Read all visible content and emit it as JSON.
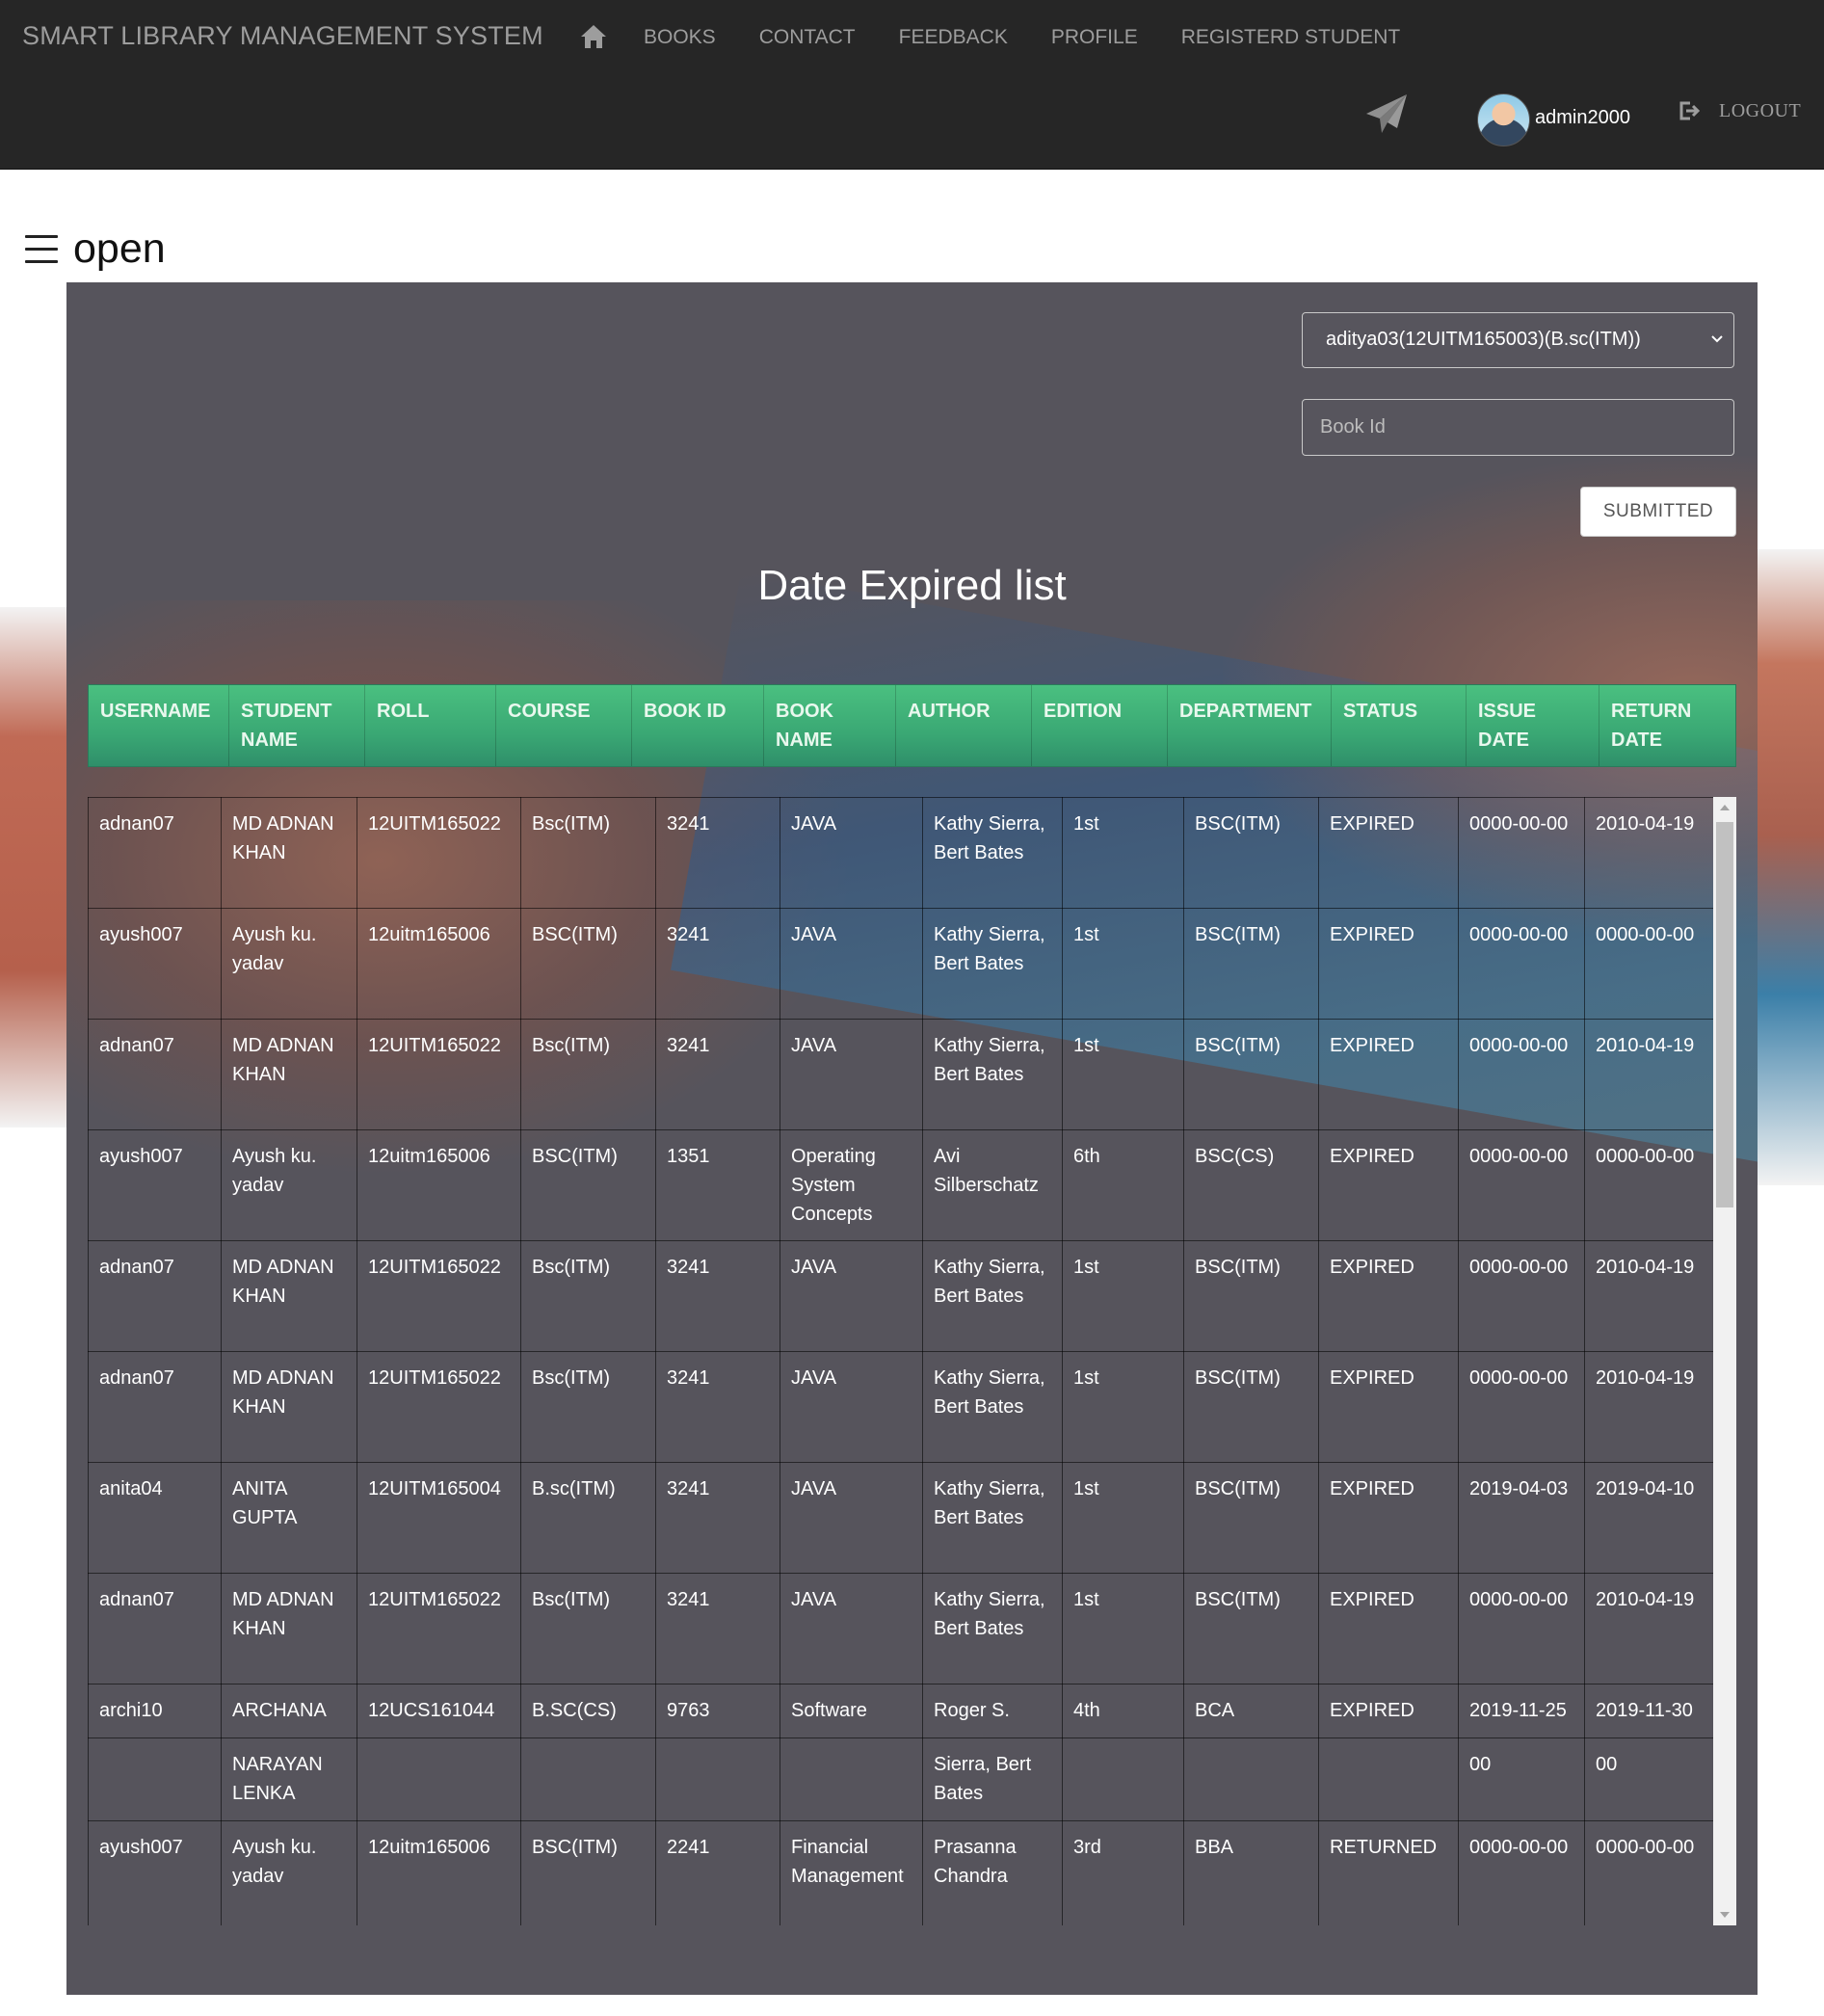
{
  "nav": {
    "brand": "SMART LIBRARY MANAGEMENT SYSTEM",
    "links": [
      "BOOKS",
      "CONTACT",
      "FEEDBACK",
      "PROFILE",
      "REGISTERD STUDENT"
    ],
    "user": "admin2000",
    "logout": "LOGOUT"
  },
  "sidebar_toggle": {
    "label": "open"
  },
  "form": {
    "student_selected": "aditya03(12UITM165003)(B.sc(ITM))",
    "book_id_placeholder": "Book Id",
    "submit": "SUBMITTED"
  },
  "list": {
    "title": "Date Expired list",
    "headers": [
      [
        "USERNAME"
      ],
      [
        "STUDENT",
        "NAME"
      ],
      [
        "ROLL"
      ],
      [
        "COURSE"
      ],
      [
        "BOOK ID"
      ],
      [
        "BOOK",
        "NAME"
      ],
      [
        "AUTHOR"
      ],
      [
        "EDITION"
      ],
      [
        "DEPARTMENT"
      ],
      [
        "STATUS"
      ],
      [
        "ISSUE",
        "DATE"
      ],
      [
        "RETURN",
        "DATE"
      ]
    ],
    "rows": [
      [
        "adnan07",
        "MD ADNAN KHAN",
        "12UITM165022",
        "Bsc(ITM)",
        "3241",
        "JAVA",
        "Kathy Sierra, Bert Bates",
        "1st",
        "BSC(ITM)",
        "EXPIRED",
        "0000-00-00",
        "2010-04-19"
      ],
      [
        "ayush007",
        "Ayush ku. yadav",
        "12uitm165006",
        "BSC(ITM)",
        "3241",
        "JAVA",
        "Kathy Sierra, Bert Bates",
        "1st",
        "BSC(ITM)",
        "EXPIRED",
        "0000-00-00",
        "0000-00-00"
      ],
      [
        "adnan07",
        "MD ADNAN KHAN",
        "12UITM165022",
        "Bsc(ITM)",
        "3241",
        "JAVA",
        "Kathy Sierra, Bert Bates",
        "1st",
        "BSC(ITM)",
        "EXPIRED",
        "0000-00-00",
        "2010-04-19"
      ],
      [
        "ayush007",
        "Ayush ku. yadav",
        "12uitm165006",
        "BSC(ITM)",
        "1351",
        "Operating System Concepts",
        "Avi Silberschatz",
        "6th",
        "BSC(CS)",
        "EXPIRED",
        "0000-00-00",
        "0000-00-00"
      ],
      [
        "adnan07",
        "MD ADNAN KHAN",
        "12UITM165022",
        "Bsc(ITM)",
        "3241",
        "JAVA",
        "Kathy Sierra, Bert Bates",
        "1st",
        "BSC(ITM)",
        "EXPIRED",
        "0000-00-00",
        "2010-04-19"
      ],
      [
        "adnan07",
        "MD ADNAN KHAN",
        "12UITM165022",
        "Bsc(ITM)",
        "3241",
        "JAVA",
        "Kathy Sierra, Bert Bates",
        "1st",
        "BSC(ITM)",
        "EXPIRED",
        "0000-00-00",
        "2010-04-19"
      ],
      [
        "anita04",
        "ANITA GUPTA",
        "12UITM165004",
        "B.sc(ITM)",
        "3241",
        "JAVA",
        "Kathy Sierra, Bert Bates",
        "1st",
        "BSC(ITM)",
        "EXPIRED",
        "2019-04-03",
        "2019-04-10"
      ],
      [
        "adnan07",
        "MD ADNAN KHAN",
        "12UITM165022",
        "Bsc(ITM)",
        "3241",
        "JAVA",
        "Kathy Sierra, Bert Bates",
        "1st",
        "BSC(ITM)",
        "EXPIRED",
        "0000-00-00",
        "2010-04-19"
      ],
      [
        "archi10",
        "ARCHANA",
        "12UCS161044",
        "B.SC(CS)",
        "9763",
        "Software",
        "Roger S.",
        "4th",
        "BCA",
        "EXPIRED",
        "2019-11-25",
        "2019-11-30"
      ],
      [
        "",
        "NARAYAN LENKA",
        "",
        "",
        "",
        "",
        "Sierra, Bert Bates",
        "",
        "",
        "",
        "00",
        "00"
      ],
      [
        "ayush007",
        "Ayush ku. yadav",
        "12uitm165006",
        "BSC(ITM)",
        "2241",
        "Financial Management",
        "Prasanna Chandra",
        "3rd",
        "BBA",
        "RETURNED",
        "0000-00-00",
        "0000-00-00"
      ]
    ]
  }
}
